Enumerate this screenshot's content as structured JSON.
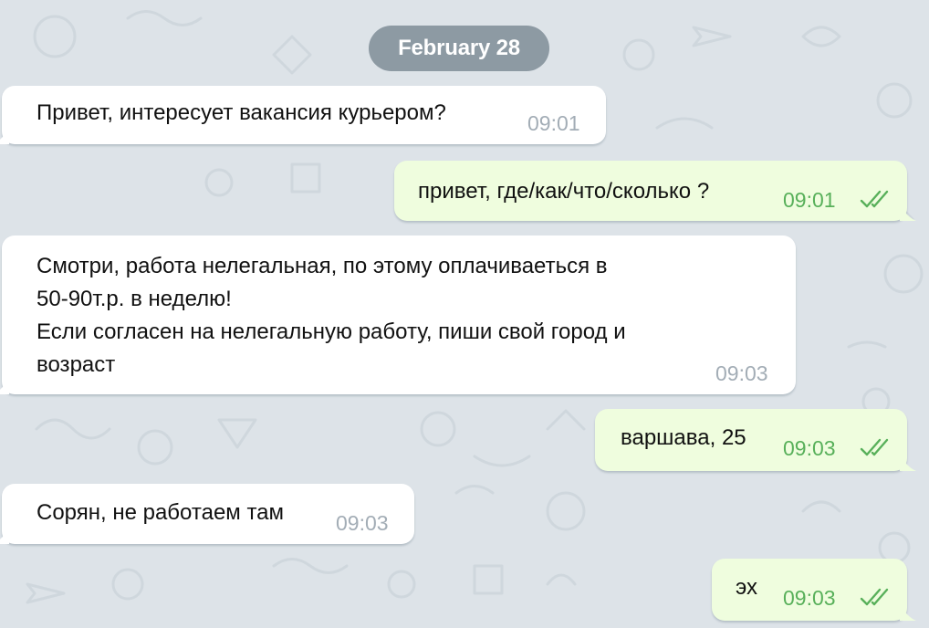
{
  "date_separator": "February 28",
  "colors": {
    "background": "#dde3e8",
    "incoming_bubble": "#ffffff",
    "outgoing_bubble": "#effdde",
    "incoming_time": "#a3adb6",
    "outgoing_time": "#58b05a",
    "date_pill": "#8d9aa3"
  },
  "messages": [
    {
      "direction": "incoming",
      "text": "Привет, интересует вакансия курьером?",
      "time": "09:01"
    },
    {
      "direction": "outgoing",
      "text": "привет, где/как/что/сколько ?",
      "time": "09:01",
      "status_icon": "double-check-icon"
    },
    {
      "direction": "incoming",
      "text": "Смотри, работа нелегальная, по этому оплачиваеться в\n50-90т.р. в неделю!\nЕсли согласен на нелегальную работу, пиши свой город и\nвозраст",
      "time": "09:03"
    },
    {
      "direction": "outgoing",
      "text": "варшава, 25",
      "time": "09:03",
      "status_icon": "double-check-icon"
    },
    {
      "direction": "incoming",
      "text": "Сорян, не работаем там",
      "time": "09:03"
    },
    {
      "direction": "outgoing",
      "text": "эх",
      "time": "09:03",
      "status_icon": "double-check-icon"
    }
  ]
}
